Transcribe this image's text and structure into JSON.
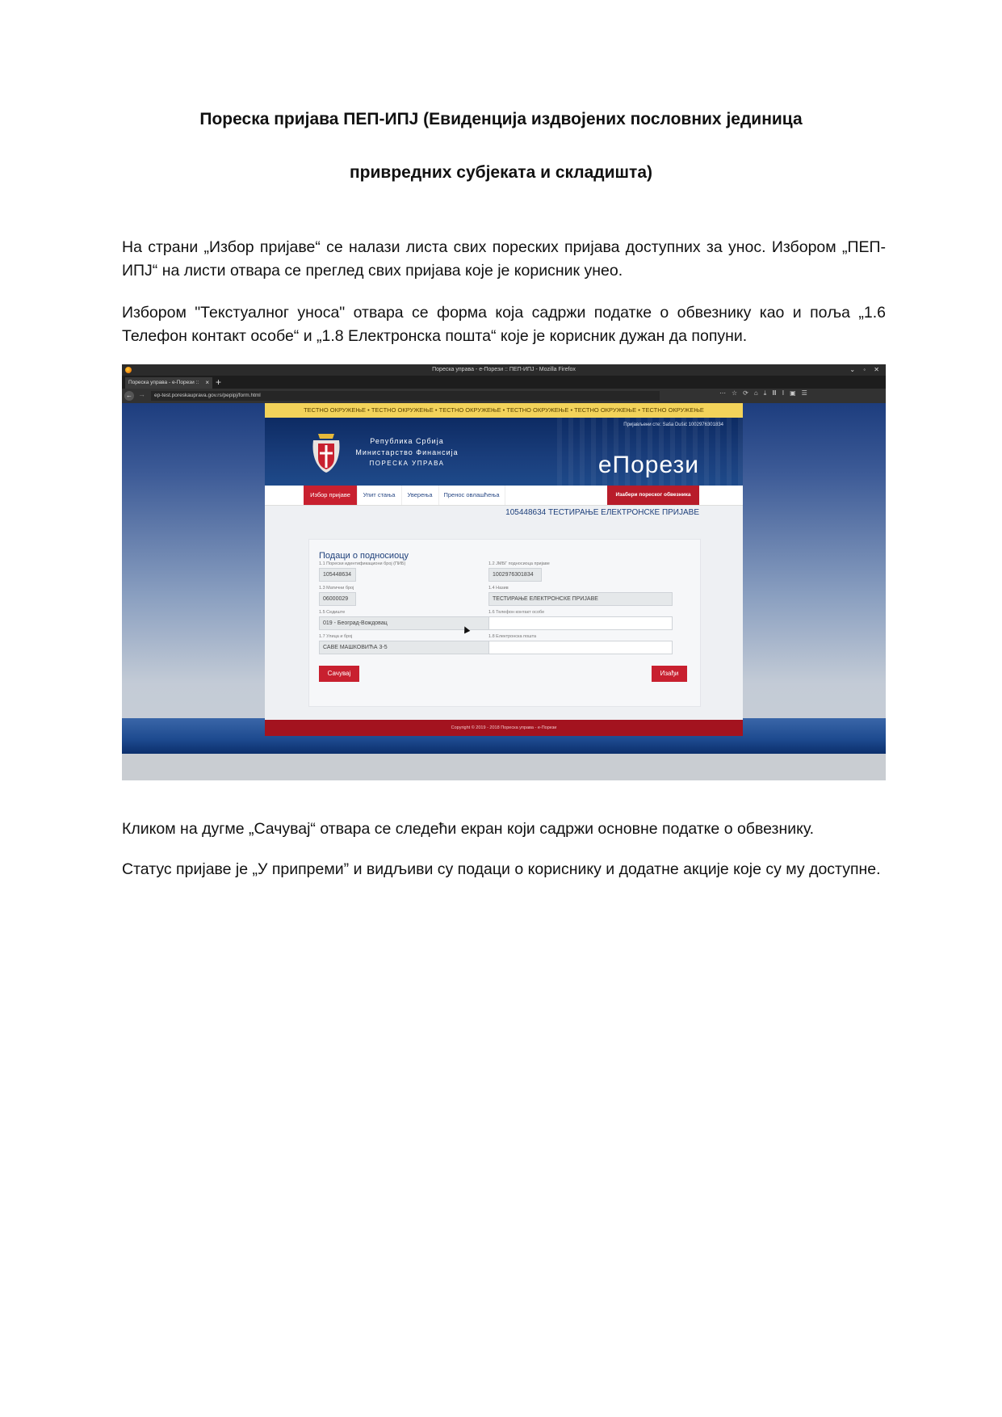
{
  "document": {
    "title_line1": "Пореска пријава ПЕП-ИПЈ (Евиденција издвојених пословних јединица",
    "title_line2": "привредних субјеката и складишта)",
    "para1": "На страни „Избор пријаве“ се налази листа свих пореских пријава доступних за унос. Избором „ПЕП-ИПЈ“ на листи отвара се преглед свих пријава које је корисник унео.",
    "para2": "Избором \"Текстуалног уноса\" отвара се форма која садржи податке о обвезнику као и поља „1.6 Телефон контакт особе“ и „1.8 Електронска пошта“ које је корисник дужан да попуни.",
    "para3": "Кликом на дугме „Сачувај“ отвара се следећи екран који садржи основне податке о обвезнику.",
    "para4": "Статус пријаве је „У припреми” и видљиви су подаци о кориснику и додатне акције које су му доступне."
  },
  "browser": {
    "window_title": "Пореска управа - е-Порези :: ПЕП-ИПЈ - Mozilla Firefox",
    "tab_label": "Пореска управа - е-Порези ::",
    "url": "ep-test.poreskaupravа.gov.rs/pepipj/form.html",
    "icon_names": [
      "firefox-logo-icon",
      "back-icon",
      "forward-icon",
      "bookmark-star-icon",
      "menu-icon"
    ]
  },
  "site": {
    "test_banner": "ТЕСТНО ОКРУЖЕЊЕ  •  ТЕСТНО ОКРУЖЕЊЕ  •  ТЕСТНО ОКРУЖЕЊЕ  •  ТЕСТНО ОКРУЖЕЊЕ  •  ТЕСТНО ОКРУЖЕЊЕ  •  ТЕСТНО ОКРУЖЕЊЕ",
    "org_line1": "Република Србија",
    "org_line2": "Министарство Финансија",
    "org_line3": "ПОРЕСКА УПРАВА",
    "user_info": "Пријављени сте:     Saša Dušić 1002976301834",
    "brand": "еПорези",
    "nav": [
      "Избор пријаве",
      "Упит стања",
      "Уверења",
      "Пренос овлашћења"
    ],
    "pick_taxpayer": "Изабери пореског обвезника",
    "subject": "105448634 ТЕСТИРАЊЕ ЕЛЕКТРОНСКЕ ПРИЈАВЕ",
    "panel_title": "Подаци о подносиоцу",
    "fields": {
      "f11_label": "1.1 Порески идентификациони број (ПИБ)",
      "f11_value": "105448634",
      "f12_label": "1.2 ЈМБГ подносиоца пријаве",
      "f12_value": "1002976301834",
      "f13_label": "1.3 Матични број",
      "f13_value": "06000029",
      "f14_label": "1.4 Назив",
      "f14_value": "ТЕСТИРАЊЕ ЕЛЕКТРОНСКЕ ПРИЈАВЕ",
      "f15_label": "1.5 Седиште",
      "f15_value": "019 - Београд-Вождовац",
      "f16_label": "1.6 Телефон контакт особе",
      "f16_value": "",
      "f17_label": "1.7 Улица и број",
      "f17_value": "САВЕ МАШКОВИЋА 3-5",
      "f18_label": "1.8 Електронска пошта",
      "f18_value": ""
    },
    "save_button": "Сачувај",
    "exit_button": "Изађи",
    "footer": "Copyright © 2019 - 2018 Пореска управа - е-Порези",
    "colors": {
      "accent_red": "#c8202f",
      "nav_blue": "#1d3f7a",
      "banner_yellow": "#f3d35a"
    }
  }
}
